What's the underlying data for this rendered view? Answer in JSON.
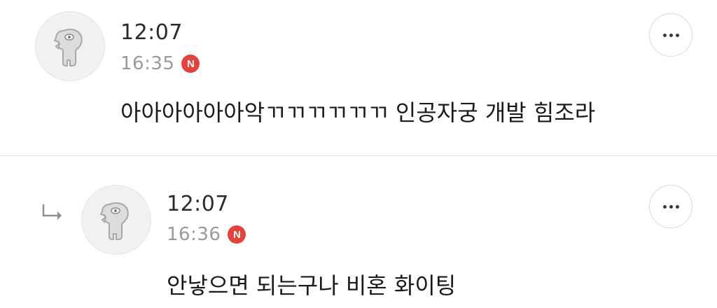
{
  "comments": [
    {
      "name": "12:07",
      "time": "16:35",
      "badge": "N",
      "text": "아아아아아아악ㄲㄲㄲㄲㄲㄲ 인공자궁 개발 힘조라",
      "avatar_icon": "character-avatar-icon",
      "more_icon": "more-dots-icon"
    },
    {
      "name": "12:07",
      "time": "16:36",
      "badge": "N",
      "text": "안낳으면 되는구나 비혼 화이팅",
      "avatar_icon": "character-avatar-icon",
      "more_icon": "more-dots-icon",
      "reply_icon": "reply-arrow-icon"
    }
  ],
  "colors": {
    "badge": "#e8413c",
    "time": "#9a9a9a",
    "divider": "#e3e3e3"
  }
}
